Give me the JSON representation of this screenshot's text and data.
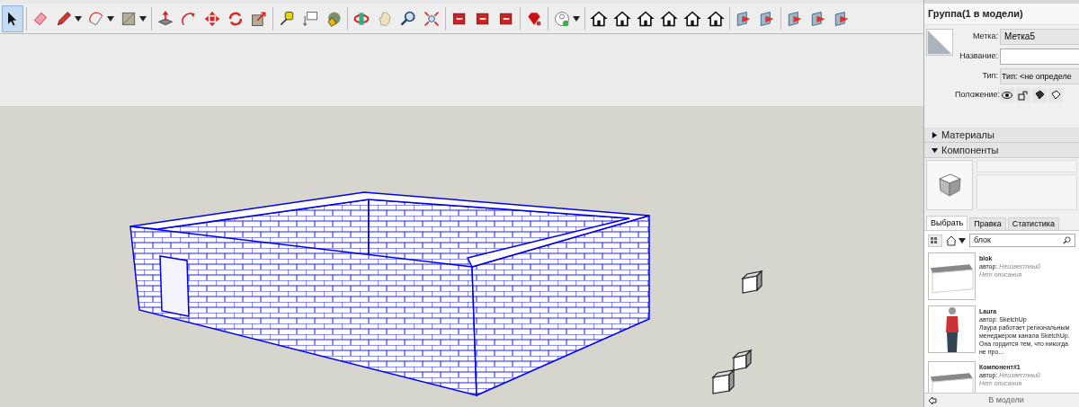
{
  "toolbar": {
    "tools": [
      {
        "kind": "select",
        "selected": true,
        "has_menu": false
      },
      {
        "kind": "separator"
      },
      {
        "kind": "eraser",
        "selected": false,
        "has_menu": false
      },
      {
        "kind": "pencil",
        "selected": false,
        "has_menu": true
      },
      {
        "kind": "arc",
        "selected": false,
        "has_menu": true
      },
      {
        "kind": "rectangle",
        "selected": false,
        "has_menu": true
      },
      {
        "kind": "separator"
      },
      {
        "kind": "pushpull",
        "selected": false,
        "has_menu": false
      },
      {
        "kind": "followme",
        "selected": false,
        "has_menu": false
      },
      {
        "kind": "move",
        "selected": false,
        "has_menu": false
      },
      {
        "kind": "rotate",
        "selected": false,
        "has_menu": false
      },
      {
        "kind": "scale",
        "selected": false,
        "has_menu": false
      },
      {
        "kind": "separator"
      },
      {
        "kind": "tape",
        "selected": false,
        "has_menu": false
      },
      {
        "kind": "text",
        "selected": false,
        "has_menu": false
      },
      {
        "kind": "paint",
        "selected": false,
        "has_menu": false
      },
      {
        "kind": "separator"
      },
      {
        "kind": "orbit",
        "selected": false,
        "has_menu": false
      },
      {
        "kind": "pan",
        "selected": false,
        "has_menu": false
      },
      {
        "kind": "zoom",
        "selected": false,
        "has_menu": false
      },
      {
        "kind": "zoom_extents",
        "selected": false,
        "has_menu": false
      },
      {
        "kind": "separator"
      },
      {
        "kind": "extension",
        "selected": false,
        "has_menu": false
      },
      {
        "kind": "extension",
        "selected": false,
        "has_menu": false
      },
      {
        "kind": "extension",
        "selected": false,
        "has_menu": false
      },
      {
        "kind": "separator"
      },
      {
        "kind": "gem",
        "selected": false,
        "has_menu": false
      },
      {
        "kind": "separator"
      },
      {
        "kind": "user",
        "selected": false,
        "has_menu": true
      },
      {
        "kind": "separator"
      },
      {
        "kind": "house",
        "selected": false,
        "has_menu": false
      },
      {
        "kind": "house",
        "selected": false,
        "has_menu": false
      },
      {
        "kind": "house",
        "selected": false,
        "has_menu": false
      },
      {
        "kind": "house",
        "selected": false,
        "has_menu": false
      },
      {
        "kind": "house",
        "selected": false,
        "has_menu": false
      },
      {
        "kind": "house",
        "selected": false,
        "has_menu": false
      },
      {
        "kind": "separator"
      },
      {
        "kind": "section",
        "selected": false,
        "has_menu": false
      },
      {
        "kind": "section",
        "selected": false,
        "has_menu": false
      },
      {
        "kind": "separator"
      },
      {
        "kind": "section",
        "selected": false,
        "has_menu": false
      },
      {
        "kind": "section",
        "selected": false,
        "has_menu": false
      },
      {
        "kind": "section",
        "selected": false,
        "has_menu": false
      }
    ]
  },
  "entity_info": {
    "title": "Группа(1 в модели)",
    "fields": [
      {
        "label": "Метка:",
        "kind": "dropdown",
        "value": "Метка5"
      },
      {
        "label": "Название:",
        "kind": "input"
      },
      {
        "label": "Тип:",
        "kind": "readonly",
        "value": "Тип: <не определе"
      },
      {
        "label": "Положение:",
        "kind": "toggles"
      }
    ]
  },
  "sections": [
    {
      "title": "Материалы",
      "expanded": false
    },
    {
      "title": "Компоненты",
      "expanded": true
    }
  ],
  "components": {
    "tabs": [
      {
        "label": "Выбрать",
        "selected": true
      },
      {
        "label": "Правка",
        "selected": false
      },
      {
        "label": "Статистика",
        "selected": false
      }
    ],
    "search": {
      "value": "блок"
    },
    "items": [
      {
        "name": "blok",
        "author_label": "автор:",
        "author": "Неизвестный",
        "description": "Нет описания",
        "unknown": true,
        "kind": "slab"
      },
      {
        "name": "Laura",
        "author_label": "автор:",
        "author": "SketchUp",
        "description": "Лаура работает региональным менеджером канала SketchUp. Она гордится тем, что никогда не про...",
        "unknown": false,
        "kind": "figure"
      },
      {
        "name": "Компонент#1",
        "author_label": "автор:",
        "author": "Неизвестный",
        "description": "Нет описания",
        "unknown": true,
        "kind": "slab"
      }
    ],
    "footer": "В модели"
  }
}
